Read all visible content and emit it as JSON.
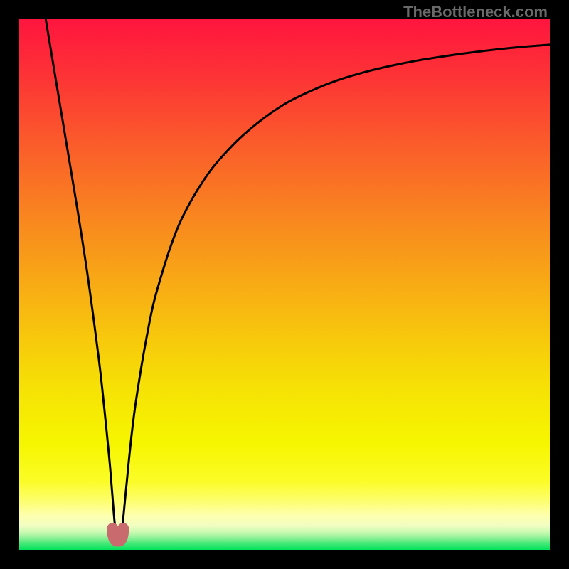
{
  "watermark": "TheBottleneck.com",
  "colors": {
    "frame": "#000000",
    "watermark": "#6a6a6a",
    "curve": "#000000",
    "marker_fill": "#c86a6e",
    "marker_stroke": "#c86a6e",
    "gradient_top": "#fe153e",
    "gradient_green": "#00e35c"
  },
  "chart_data": {
    "type": "line",
    "title": "",
    "xlabel": "",
    "ylabel": "",
    "xlim": [
      0,
      100
    ],
    "ylim": [
      0,
      100
    ],
    "x_optimum": 18.5,
    "series": [
      {
        "name": "bottleneck-curve",
        "x": [
          5,
          7,
          9,
          11,
          13,
          15,
          16,
          17,
          17.5,
          18,
          18.5,
          19,
          19.5,
          20,
          21,
          22,
          24,
          26,
          30,
          35,
          40,
          45,
          50,
          55,
          60,
          65,
          70,
          75,
          80,
          85,
          90,
          95,
          100
        ],
        "y": [
          100,
          88,
          76,
          64,
          51,
          36,
          27,
          17,
          11,
          5,
          1.5,
          1.8,
          5,
          10,
          20,
          28,
          40,
          49,
          61,
          70,
          76,
          80.5,
          84,
          86.5,
          88.5,
          90,
          91.2,
          92.2,
          93,
          93.7,
          94.3,
          94.8,
          95.2
        ]
      }
    ],
    "markers": [
      {
        "name": "min-left",
        "x": 17.6,
        "y": 4.0
      },
      {
        "name": "min-right",
        "x": 19.6,
        "y": 4.0
      }
    ],
    "annotations": []
  }
}
